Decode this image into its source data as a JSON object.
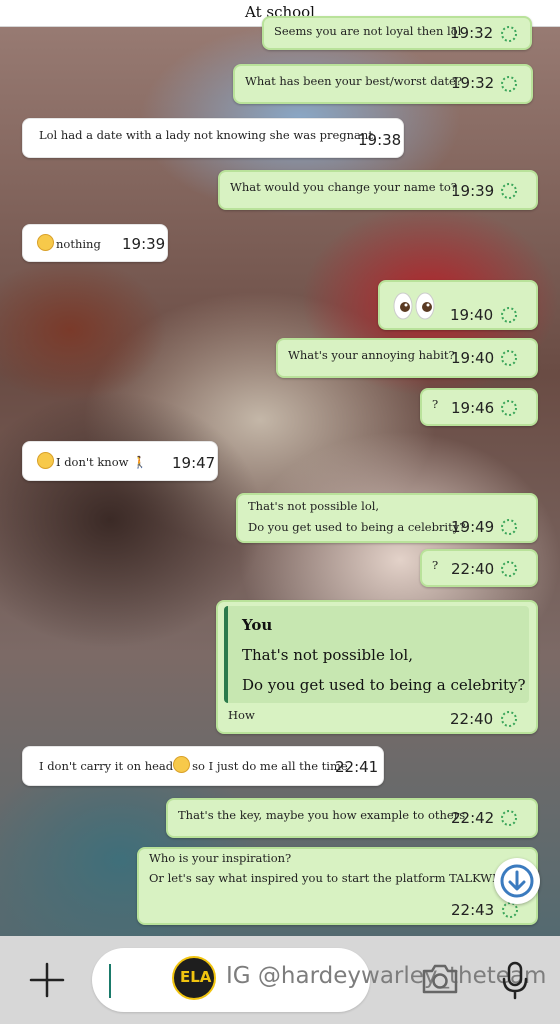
{
  "header": {
    "title": "At school"
  },
  "messages": [
    {
      "text": "Seems you are not loyal then lol",
      "time": "19:32"
    },
    {
      "text": "What has been your best/worst date?",
      "time": "19:32"
    },
    {
      "text": "Lol had a date with a lady not knowing she was pregnant",
      "time": "19:38"
    },
    {
      "text": "What would you change your name to?",
      "time": "19:39"
    },
    {
      "text": "nothing",
      "time": "19:39"
    },
    {
      "text": "",
      "time": "19:40"
    },
    {
      "text": "What's your annoying habit?",
      "time": "19:40"
    },
    {
      "text": "?",
      "time": "19:46"
    },
    {
      "text": "I don't know",
      "time": "19:47"
    },
    {
      "line1": "That's not possible lol,",
      "line2": "Do you get used to being a celebrity?",
      "time": "19:49"
    },
    {
      "text": "?",
      "time": "22:40"
    },
    {
      "quote_author": "You",
      "quote_line1": "That's not possible lol,",
      "quote_line2": "Do you get used to being a celebrity?",
      "text": "How",
      "time": "22:40"
    },
    {
      "text_before": "I don't carry it on head",
      "text_after": "so I just do me all the time",
      "time": "22:41"
    },
    {
      "text": "That's the key, maybe you how example to others",
      "time": "22:42"
    },
    {
      "line1": "Who is your inspiration?",
      "line2": "Or let's say what inspired you to start the platform TALKWITHSI",
      "time": "22:43"
    }
  ],
  "input": {
    "placeholder": ""
  },
  "watermark": {
    "text": "IG @hardeywarley_theteam",
    "logo_text": "ELA"
  },
  "icons": {
    "add": "plus-icon",
    "camera": "camera-icon",
    "mic": "microphone-icon",
    "status": "pending-clock-icon",
    "scroll": "scroll-down-icon"
  },
  "colors": {
    "outgoing_bubble": "#d8f2c2",
    "incoming_bubble": "#ffffff",
    "quote_bar": "#2b7a4b",
    "status_icon": "#3aa55a"
  }
}
